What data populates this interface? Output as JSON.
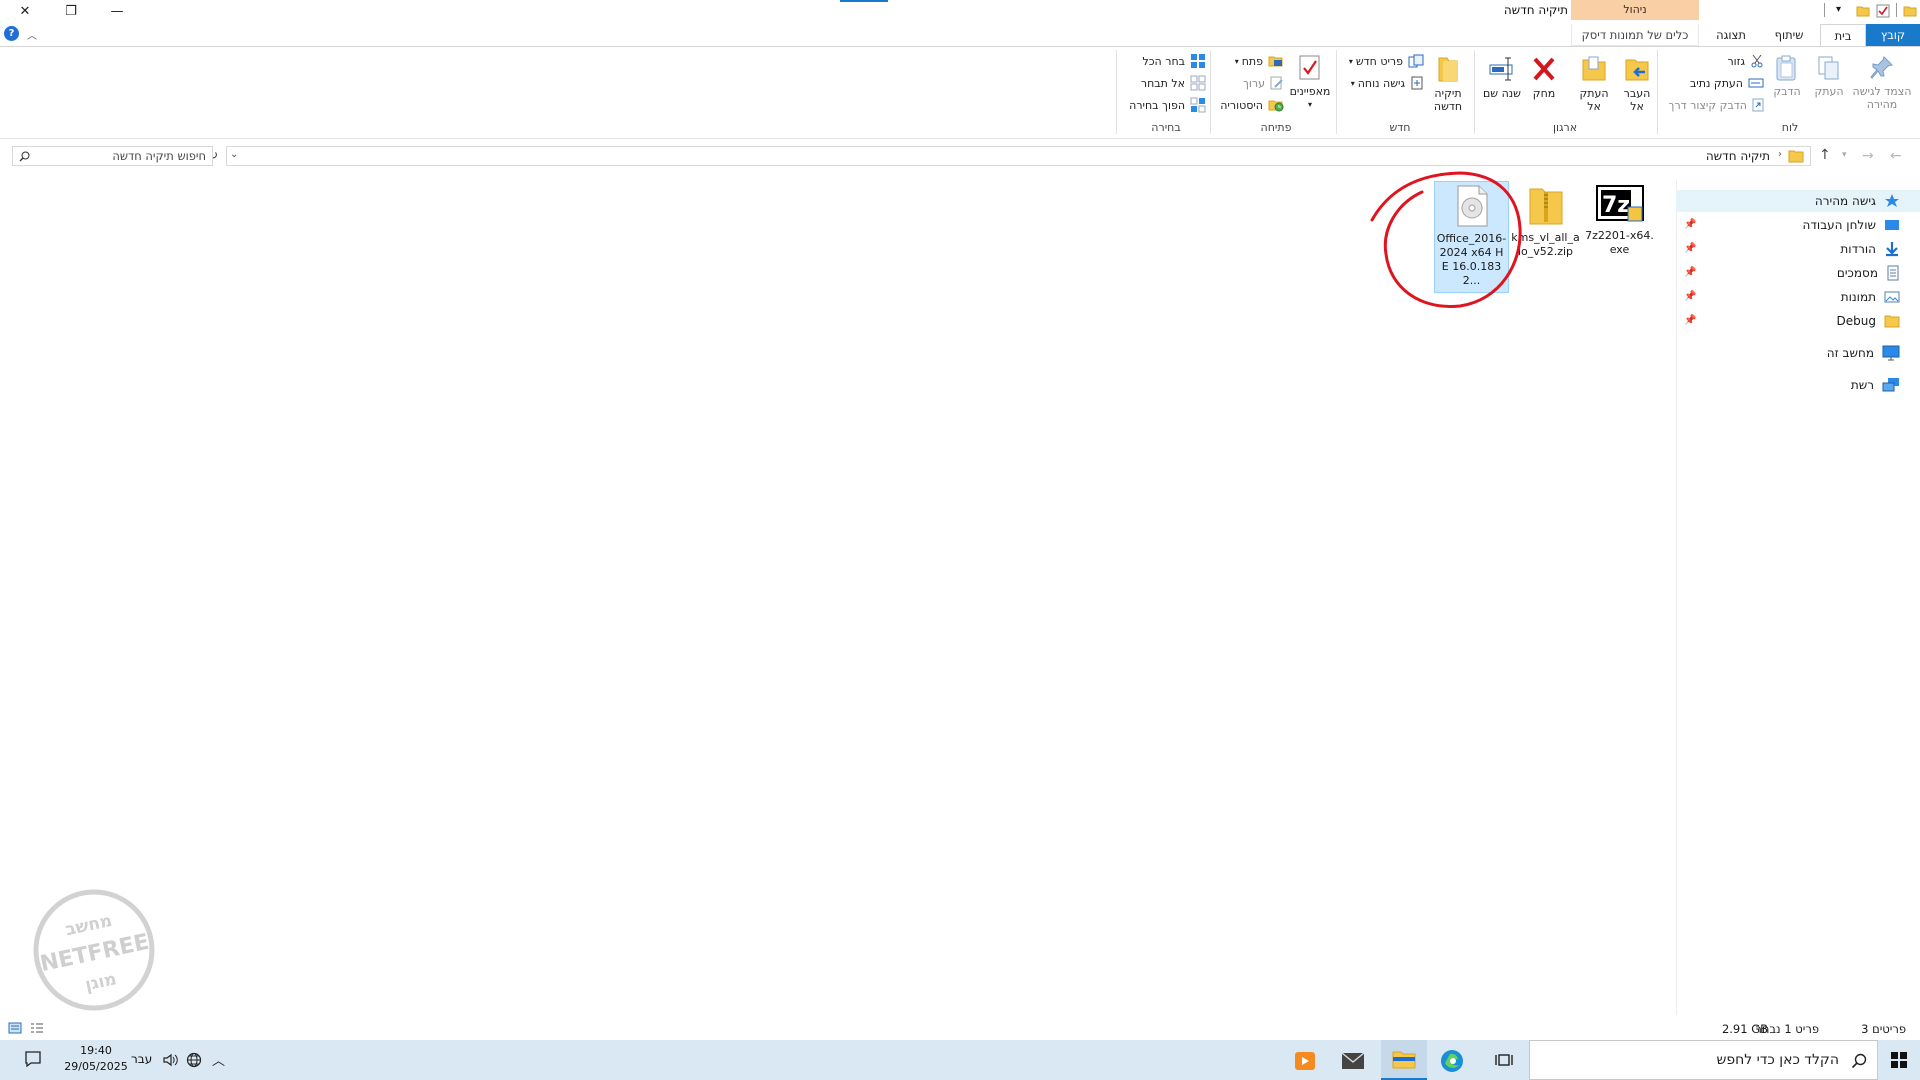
{
  "window": {
    "title": "תיקיה חדשה",
    "context_group_label": "ניהול",
    "minimize_glyph": "—",
    "restore_glyph": "❐",
    "close_glyph": "✕"
  },
  "tabs": {
    "file": "קובץ",
    "home": "בית",
    "share": "שיתוף",
    "view": "תצוגה",
    "disc_tools": "כלים של תמונות דיסק"
  },
  "ribbon": {
    "clipboard": {
      "label": "לוח",
      "pin_quick_access": "הצמד לגישה מהירה",
      "copy": "העתק",
      "paste": "הדבק",
      "cut": "גזור",
      "copy_path": "העתק נתיב",
      "paste_shortcut": "הדבק קיצור דרך"
    },
    "organize": {
      "label": "ארגון",
      "move_to": "העבר אל",
      "copy_to": "העתק אל",
      "delete": "מחק",
      "rename": "שנה שם"
    },
    "new": {
      "label": "חדש",
      "new_folder": "תיקיה חדשה",
      "new_item": "פריט חדש",
      "easy_access": "גישה נוחה"
    },
    "open": {
      "label": "פתיחה",
      "properties": "מאפיינים",
      "open": "פתח",
      "edit": "ערוך",
      "history": "היסטוריה"
    },
    "select": {
      "label": "בחירה",
      "select_all": "בחר הכל",
      "select_none": "אל תבחר",
      "invert_selection": "הפוך בחירה"
    }
  },
  "address": {
    "breadcrumb": "תיקיה חדשה",
    "search_placeholder": "חיפוש תיקיה חדשה"
  },
  "nav_pane": {
    "quick_access": "גישה מהירה",
    "items": [
      {
        "label": "שולחן העבודה",
        "icon": "desktop-icon",
        "pinned": true
      },
      {
        "label": "הורדות",
        "icon": "downloads-icon",
        "pinned": true
      },
      {
        "label": "מסמכים",
        "icon": "documents-icon",
        "pinned": true
      },
      {
        "label": "תמונות",
        "icon": "pictures-icon",
        "pinned": true
      },
      {
        "label": "Debug",
        "icon": "folder-icon",
        "pinned": true
      }
    ],
    "this_pc": "מחשב זה",
    "network": "רשת"
  },
  "files": [
    {
      "name": "Office_2016-2024 x64 HE 16.0.1832...",
      "type": "disc-image",
      "selected": true
    },
    {
      "name": "kms_vl_all_aio_v52.zip",
      "type": "zip",
      "selected": false
    },
    {
      "name": "7z2201-x64.exe",
      "type": "exe",
      "selected": false
    }
  ],
  "status": {
    "item_count": "3 פריטים",
    "selection": "פריט 1 נבחר",
    "size": "2.91 GB"
  },
  "watermark": {
    "top": "מחשב",
    "middle": "NETFREE",
    "bottom": "מוגן"
  },
  "taskbar": {
    "search_placeholder": "הקלד כאן כדי לחפש",
    "time": "19:40",
    "date": "29/05/2025",
    "language": "עבר"
  },
  "colors": {
    "accent": "#1979ca",
    "selection_bg": "#cce8ff",
    "context_tab": "#f9cfa6",
    "annotation": "#e0141e",
    "taskbar": "#d9e8f3"
  }
}
